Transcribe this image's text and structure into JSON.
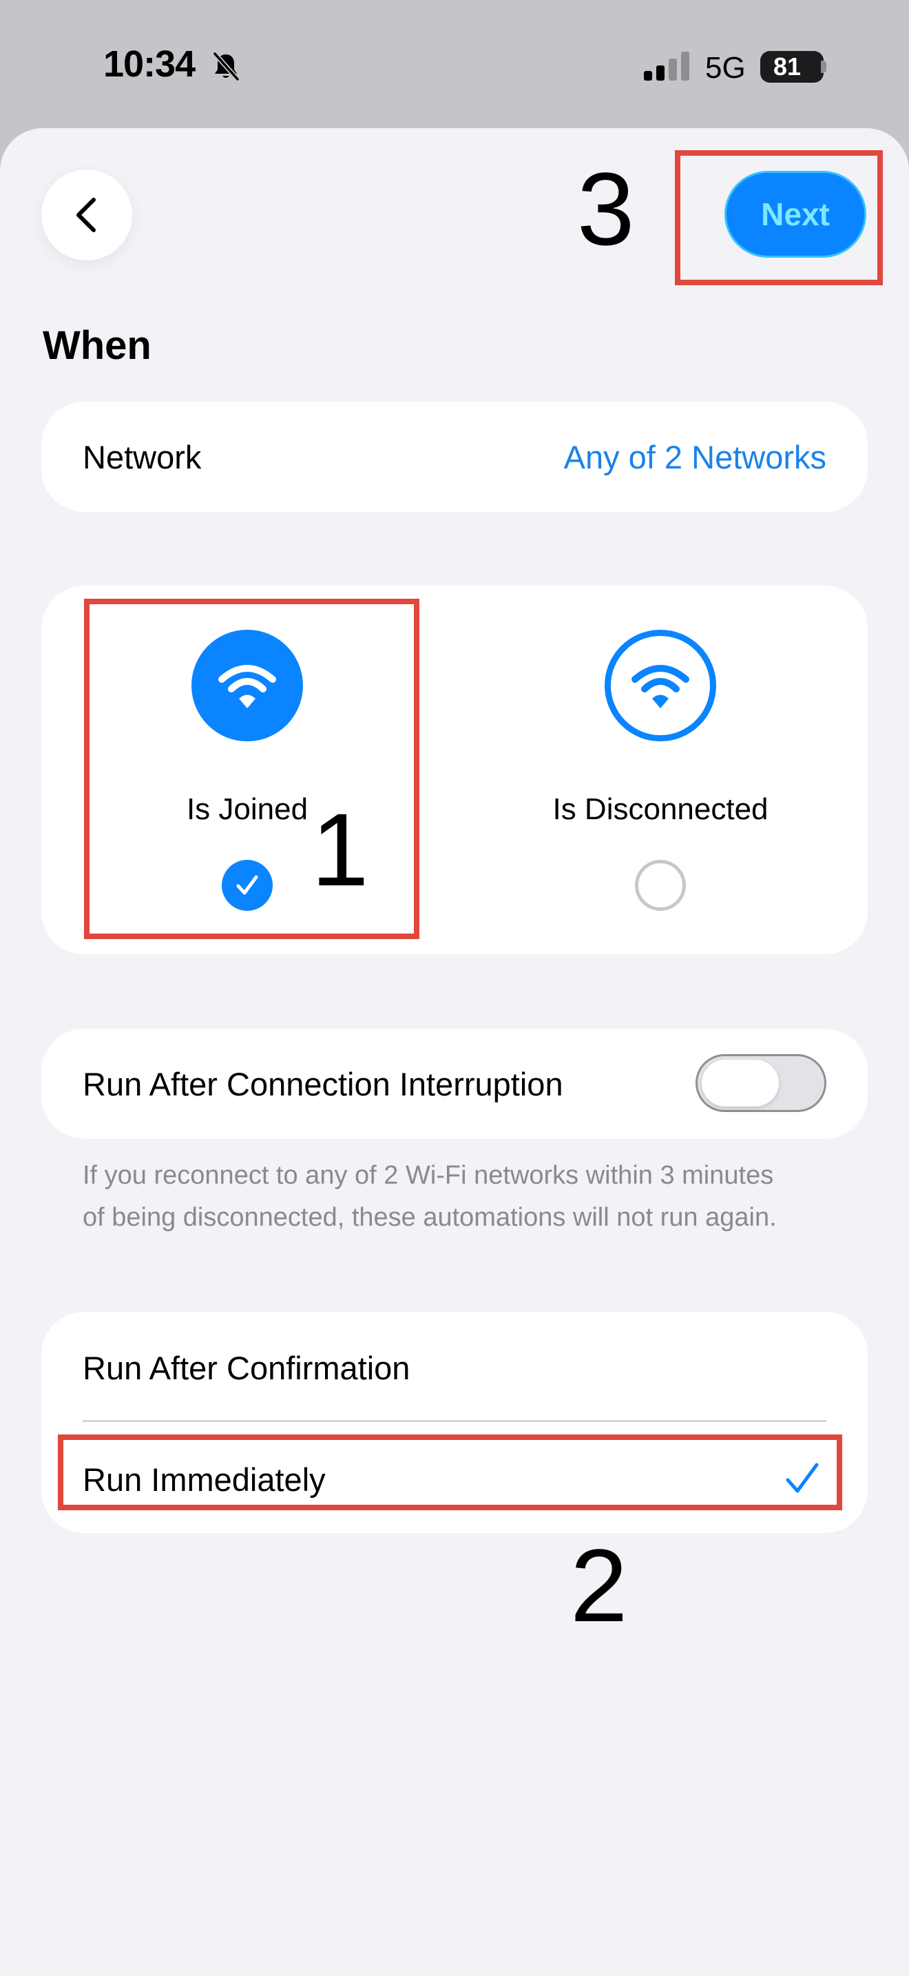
{
  "status_bar": {
    "time": "10:34",
    "network_type": "5G",
    "battery": "81",
    "icons": [
      "bell-slash-icon",
      "cellular-signal-icon",
      "battery-icon"
    ]
  },
  "nav": {
    "back_icon": "chevron-left-icon",
    "next_label": "Next"
  },
  "when": {
    "title": "When",
    "network_label": "Network",
    "network_value": "Any of 2 Networks"
  },
  "trigger": {
    "options": [
      {
        "label": "Is Joined",
        "icon": "wifi-icon",
        "selected": true
      },
      {
        "label": "Is Disconnected",
        "icon": "wifi-icon",
        "selected": false
      }
    ]
  },
  "interruption": {
    "label": "Run After Connection Interruption",
    "enabled": false,
    "footnote": "If you reconnect to any of 2 Wi-Fi networks within 3 minutes of being disconnected, these automations will not run again."
  },
  "run_mode": {
    "options": [
      {
        "label": "Run After Confirmation",
        "selected": false
      },
      {
        "label": "Run Immediately",
        "selected": true
      }
    ]
  },
  "annotations": {
    "step1": "1",
    "step2": "2",
    "step3": "3"
  },
  "colors": {
    "accent": "#0a84ff",
    "link": "#1a82e8",
    "annotation": "#e0473d",
    "background": "#f2f2f7"
  }
}
